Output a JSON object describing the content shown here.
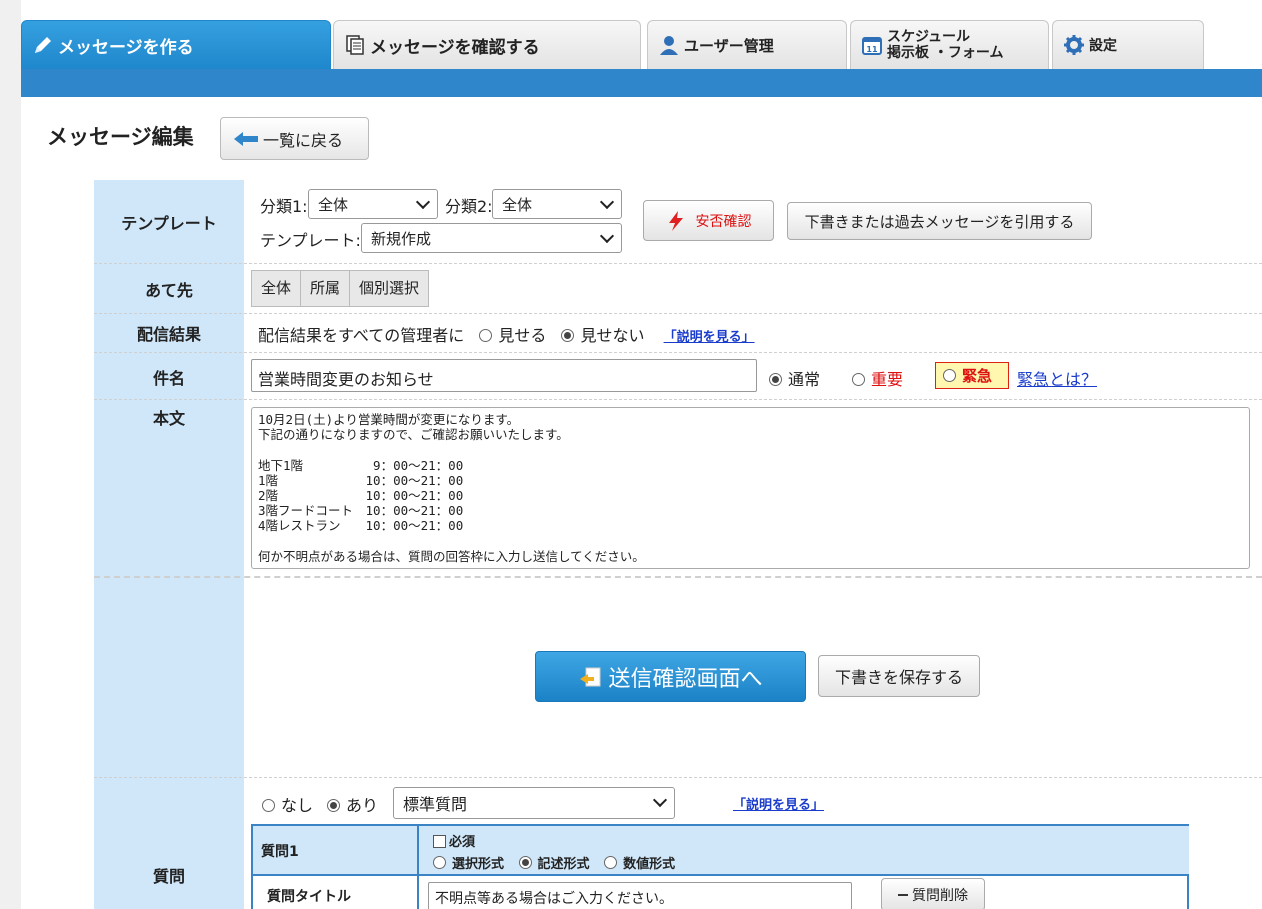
{
  "tabs": [
    {
      "label": "メッセージを作る",
      "icon": "pencil-icon",
      "active": true
    },
    {
      "label": "メッセージを確認する",
      "icon": "document-icon"
    },
    {
      "label": "ユーザー管理",
      "icon": "user-icon"
    },
    {
      "label_line1": "スケジュール",
      "label_line2": "掲示板 ・フォーム",
      "icon": "calendar-icon"
    },
    {
      "label": "設定",
      "icon": "gear-icon"
    }
  ],
  "page": {
    "title": "メッセージ編集",
    "back_label": "一覧に戻る"
  },
  "template": {
    "label": "テンプレート",
    "cat1_label": "分類1:",
    "cat1_value": "全体",
    "cat2_label": "分類2:",
    "cat2_value": "全体",
    "template_label": "テンプレート:",
    "template_value": "新規作成",
    "safety_label": "安否確認",
    "quote_label": "下書きまたは過去メッセージを引用する"
  },
  "recipients": {
    "label": "あて先",
    "options": [
      "全体",
      "所属",
      "個別選択"
    ]
  },
  "delivery": {
    "label": "配信結果",
    "text": "配信結果をすべての管理者に",
    "show": "見せる",
    "hide": "見せない",
    "help": "「説明を見る」"
  },
  "subject": {
    "label": "件名",
    "value": "営業時間変更のお知らせ",
    "normal": "通常",
    "important": "重要",
    "urgent": "緊急",
    "urgent_help": "緊急とは？"
  },
  "body": {
    "label": "本文",
    "text": "10月2日(土)より営業時間が変更になります。\n下記の通りになりますので、ご確認お願いいたします。\n\n地下1階　　　　　 9：00〜21：00\n1階　　　　　　　10：00〜21：00\n2階　　　　　　　10：00〜21：00\n3階フードコート　10：00〜21：00\n4階レストラン　　10：00〜21：00\n\n何か不明点がある場合は、質問の回答枠に入力し送信してください。"
  },
  "actions": {
    "confirm": "送信確認画面へ",
    "save_draft": "下書きを保存する"
  },
  "question": {
    "label": "質問",
    "none": "なし",
    "yes": "あり",
    "select_value": "標準質問",
    "help": "「説明を見る」",
    "q1_label": "質問1",
    "required": "必須",
    "format_select": "選択形式",
    "format_text": "記述形式",
    "format_number": "数値形式",
    "title_label": "質問タイトル",
    "title_value": "不明点等ある場合はご入力ください。",
    "delete_label": "質問削除"
  },
  "colors": {
    "accent": "#2f86cb",
    "label_bg": "#cfe7f9",
    "urgent": "#d11111"
  }
}
